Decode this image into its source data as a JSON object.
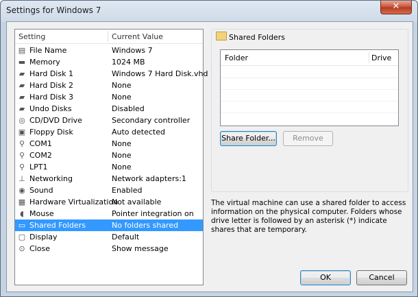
{
  "window": {
    "title": "Settings for Windows 7",
    "close_glyph": "✕"
  },
  "settings_list": {
    "headers": {
      "setting": "Setting",
      "value": "Current Value"
    },
    "rows": [
      {
        "icon": "file-icon",
        "glyph": "▤",
        "name": "File Name",
        "value": "Windows 7"
      },
      {
        "icon": "memory-icon",
        "glyph": "▬",
        "name": "Memory",
        "value": "1024 MB"
      },
      {
        "icon": "hard-disk-icon",
        "glyph": "▰",
        "name": "Hard Disk 1",
        "value": "Windows 7 Hard Disk.vhd"
      },
      {
        "icon": "hard-disk-icon",
        "glyph": "▰",
        "name": "Hard Disk 2",
        "value": "None"
      },
      {
        "icon": "hard-disk-icon",
        "glyph": "▰",
        "name": "Hard Disk 3",
        "value": "None"
      },
      {
        "icon": "undo-disk-icon",
        "glyph": "▰",
        "name": "Undo Disks",
        "value": "Disabled"
      },
      {
        "icon": "cd-dvd-icon",
        "glyph": "◎",
        "name": "CD/DVD Drive",
        "value": "Secondary controller"
      },
      {
        "icon": "floppy-icon",
        "glyph": "▣",
        "name": "Floppy Disk",
        "value": "Auto detected"
      },
      {
        "icon": "com-port-icon",
        "glyph": "⚲",
        "name": "COM1",
        "value": "None"
      },
      {
        "icon": "com-port-icon",
        "glyph": "⚲",
        "name": "COM2",
        "value": "None"
      },
      {
        "icon": "lpt-port-icon",
        "glyph": "⚲",
        "name": "LPT1",
        "value": "None"
      },
      {
        "icon": "network-icon",
        "glyph": "⊥",
        "name": "Networking",
        "value": "Network adapters:1"
      },
      {
        "icon": "sound-icon",
        "glyph": "◉",
        "name": "Sound",
        "value": "Enabled"
      },
      {
        "icon": "hardware-virtualization-icon",
        "glyph": "▦",
        "name": "Hardware Virtualization",
        "value": "Not available"
      },
      {
        "icon": "mouse-icon",
        "glyph": "◖",
        "name": "Mouse",
        "value": "Pointer integration on"
      },
      {
        "icon": "shared-folder-icon",
        "glyph": "▭",
        "name": "Shared Folders",
        "value": "No folders shared",
        "selected": true
      },
      {
        "icon": "display-icon",
        "glyph": "▢",
        "name": "Display",
        "value": "Default"
      },
      {
        "icon": "close-icon",
        "glyph": "⊙",
        "name": "Close",
        "value": "Show message"
      }
    ]
  },
  "shared_folders": {
    "group_title": "Shared Folders",
    "table_headers": {
      "folder": "Folder",
      "drive": "Drive"
    },
    "share_button": "Share Folder...",
    "remove_button": "Remove"
  },
  "description": "The virtual machine can use a shared folder to access information on the physical computer. Folders whose drive letter is followed by an asterisk (*) indicate shares that are temporary.",
  "footer": {
    "ok": "OK",
    "cancel": "Cancel"
  }
}
